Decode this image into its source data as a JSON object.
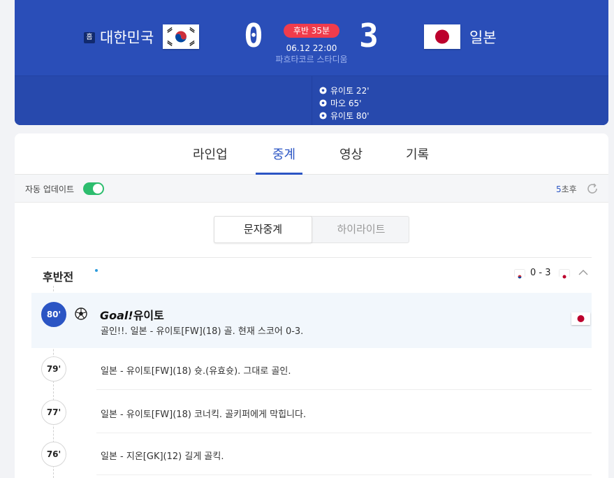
{
  "scoreboard": {
    "home_badge": "홈",
    "home_team": "대한민국",
    "away_team": "일본",
    "home_score": "0",
    "away_score": "3",
    "status": "후반 35분",
    "datetime": "06.12 22:00",
    "stadium": "파흐타코르 스타디움",
    "scorers": [
      {
        "text": "유이토 22'"
      },
      {
        "text": "마오 65'"
      },
      {
        "text": "유이토 80'"
      }
    ],
    "colors": {
      "bg": "#2a4eb8",
      "status_badge": "#f03c4c"
    }
  },
  "tabs": [
    {
      "label": "라인업"
    },
    {
      "label": "중계",
      "active": true
    },
    {
      "label": "영상"
    },
    {
      "label": "기록"
    }
  ],
  "update_bar": {
    "auto_label": "자동 업데이트",
    "auto_on": true,
    "countdown_num": "5",
    "countdown_suffix": "초후"
  },
  "subtabs": [
    {
      "label": "문자중계",
      "active": true
    },
    {
      "label": "하이라이트"
    }
  ],
  "period": {
    "title": "후반전",
    "score": "0 - 3"
  },
  "events": [
    {
      "minute": "80'",
      "title": "Goal!",
      "title_name": "유이토",
      "text": "골인!!. 일본 - 유이토[FW](18) 골. 현재 스코어 0-3."
    },
    {
      "minute": "79'",
      "text": "일본 - 유이토[FW](18) 슛.(유효슛). 그대로 골인."
    },
    {
      "minute": "77'",
      "text": "일본 - 유이토[FW](18) 코너킥. 골키퍼에게 막힙니다."
    },
    {
      "minute": "76'",
      "text": "일본 - 지온[GK](12) 길게 골킥."
    }
  ],
  "accent_color": "#2b55c4"
}
